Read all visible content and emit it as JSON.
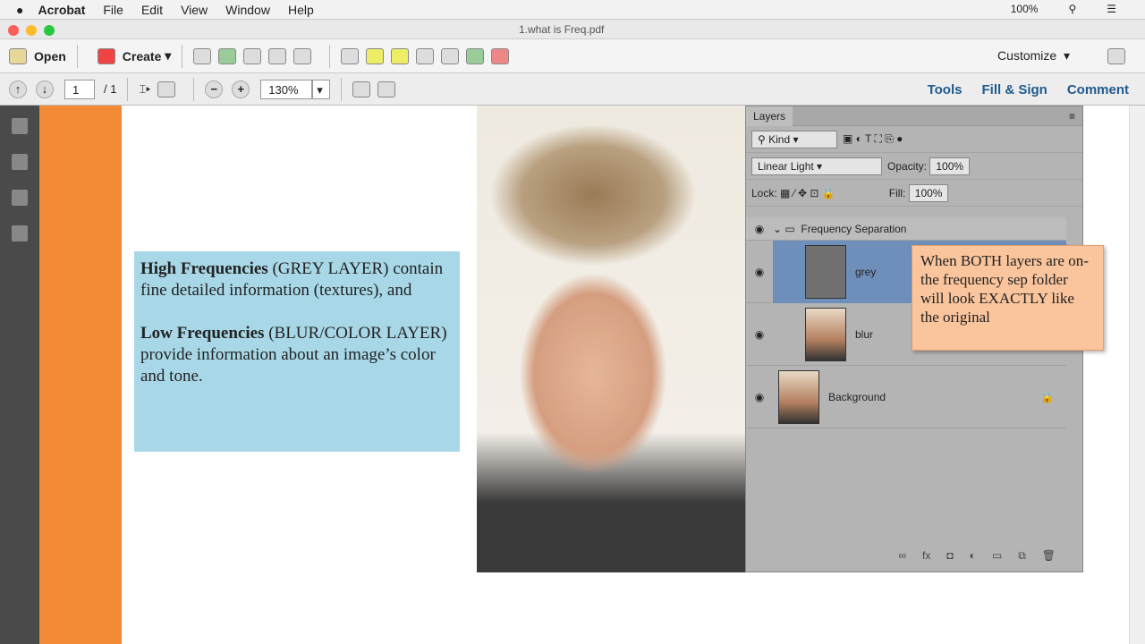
{
  "menubar": {
    "apple": "",
    "app": "Acrobat",
    "items": [
      "File",
      "Edit",
      "View",
      "Window",
      "Help"
    ],
    "battery": "100%"
  },
  "window": {
    "title": "1.what is Freq.pdf"
  },
  "toolbar": {
    "open": "Open",
    "create": "Create",
    "customize": "Customize"
  },
  "nav": {
    "page": "1",
    "total": "/ 1",
    "zoom": "130%",
    "links": [
      "Tools",
      "Fill & Sign",
      "Comment"
    ]
  },
  "doc": {
    "hf_bold": "High Frequencies",
    "hf_rest": " (GREY LAYER) contain fine detailed information (textures), and",
    "lf_bold": "Low Frequencies",
    "lf_rest": " (BLUR/COLOR LAYER) provide information about an image’s color and tone."
  },
  "layers": {
    "tab": "Layers",
    "kind": "Kind",
    "blend": "Linear Light",
    "opacity_label": "Opacity:",
    "opacity": "100%",
    "lock_label": "Lock:",
    "fill_label": "Fill:",
    "fill": "100%",
    "group": "Frequency Separation",
    "items": [
      "grey",
      "blur",
      "Background"
    ]
  },
  "note": "When BOTH layers are on- the frequency sep folder will look EXACTLY like the original"
}
